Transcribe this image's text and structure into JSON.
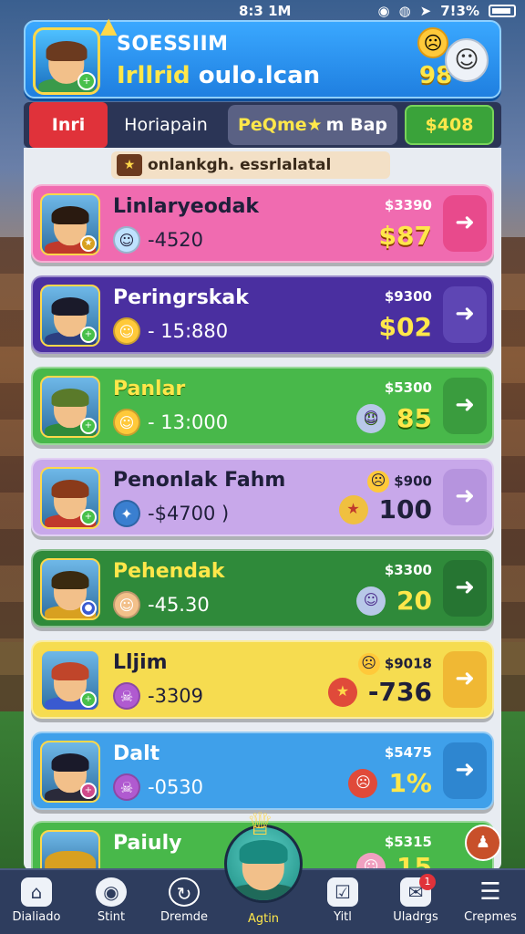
{
  "status": {
    "time": "8:3 1M",
    "battery": "7!3%"
  },
  "header": {
    "title": "SOESSIIM",
    "subtitle_accent": "Irllrid",
    "subtitle_rest": "oulo.lcan",
    "score": "98"
  },
  "tabs": [
    {
      "label": "Inri"
    },
    {
      "label": "Horiapain"
    },
    {
      "label_accent": "PeQme★",
      "label_rest": "m Bap"
    },
    {
      "label": "$408"
    }
  ],
  "banner": {
    "text": "onlankgh. essrlalatal"
  },
  "rows": [
    {
      "name": "Linlaryeodak",
      "sub": "-4520",
      "price": "$3390",
      "value": "$87",
      "coin": "#bfe2ff",
      "coin_icon": "☺"
    },
    {
      "name": "Peringrskak",
      "sub": "- 15:880",
      "price": "$9300",
      "value": "$02",
      "coin": "#ffc93a",
      "coin_icon": "☺"
    },
    {
      "name": "Panlar",
      "sub": "- 13:000",
      "price": "$5300",
      "value": "85",
      "coin": "#ffc93a",
      "coin_icon": "☺"
    },
    {
      "name": "Penonlak Fahm",
      "sub": "-$4700 )",
      "price": "$900",
      "value": "100",
      "coin": "#3a7fd0",
      "coin_icon": "✦"
    },
    {
      "name": "Pehendak",
      "sub": "-45.30",
      "price": "$3300",
      "value": "20",
      "coin": "#f2c08a",
      "coin_icon": "☺"
    },
    {
      "name": "Lljim",
      "sub": "-3309",
      "price": "$9018",
      "value": "-736",
      "coin": "#b05ad0",
      "coin_icon": "☠"
    },
    {
      "name": "Dalt",
      "sub": "-0530",
      "price": "$5475",
      "value": "1%",
      "coin": "#b05ad0",
      "coin_icon": "☠"
    },
    {
      "name": "Paiuly",
      "sub": "",
      "price": "$5315",
      "value": "15",
      "coin": "#ffc93a",
      "coin_icon": "☺"
    }
  ],
  "nav": [
    {
      "label": "Dialiado",
      "icon": "home-icon"
    },
    {
      "label": "Stint",
      "icon": "helmet-icon"
    },
    {
      "label": "Dremde",
      "icon": "refresh-icon"
    },
    {
      "label": "Agtin",
      "icon": "avatar-icon"
    },
    {
      "label": "Yitl",
      "icon": "checkbox-icon"
    },
    {
      "label": "Uladrgs",
      "icon": "mail-icon",
      "badge": "1"
    },
    {
      "label": "Crepmes",
      "icon": "menu-icon"
    }
  ]
}
